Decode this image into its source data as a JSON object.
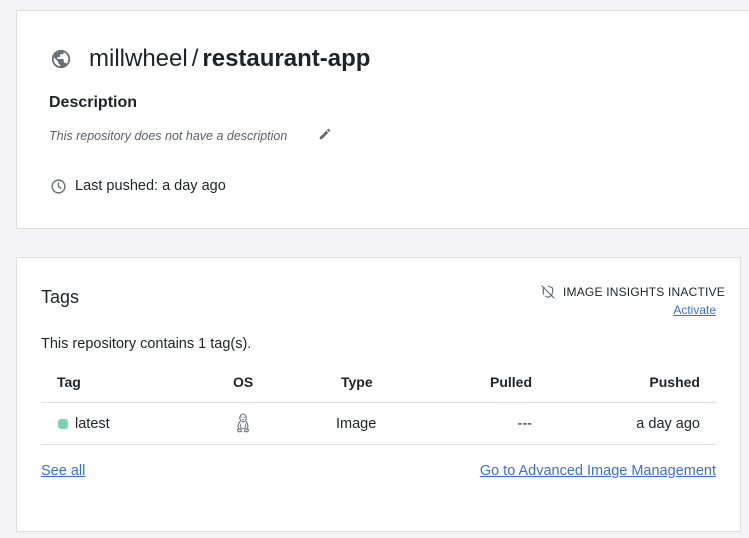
{
  "repo": {
    "namespace": "millwheel",
    "separator": "/",
    "name": "restaurant-app",
    "description_heading": "Description",
    "description_text": "This repository does not have a description",
    "last_pushed": "Last pushed: a day ago"
  },
  "tags": {
    "heading": "Tags",
    "insights_label": "IMAGE INSIGHTS INACTIVE",
    "activate_label": "Activate",
    "count_text": "This repository contains 1 tag(s).",
    "columns": {
      "tag": "Tag",
      "os": "OS",
      "type": "Type",
      "pulled": "Pulled",
      "pushed": "Pushed"
    },
    "rows": [
      {
        "tag": "latest",
        "os_icon": "linux-icon",
        "type": "Image",
        "pulled": "---",
        "pushed": "a day ago"
      }
    ],
    "see_all_label": "See all",
    "advanced_label": "Go to Advanced Image Management"
  },
  "colors": {
    "link": "#3b6fd6",
    "status_dot": "#7fd1b0",
    "icon_gray": "#6b7078",
    "border": "#dcdfe3"
  }
}
